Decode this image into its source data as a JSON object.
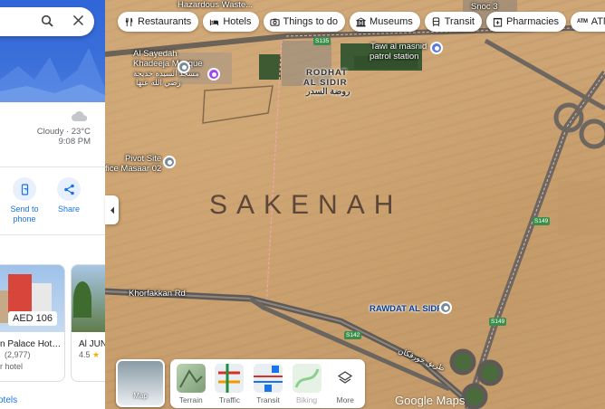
{
  "search": {
    "search_icon": "search-icon",
    "close_icon": "close-icon"
  },
  "weather": {
    "icon": "cloud-icon",
    "line1": "Cloudy · 23°C",
    "line2": "9:08 PM"
  },
  "actions": [
    {
      "label_line1": "Send to",
      "label_line2": "phone",
      "icon": "send-to-phone-icon"
    },
    {
      "label_line1": "Share",
      "label_line2": "",
      "icon": "share-icon"
    }
  ],
  "hotels": [
    {
      "price": "AED 106",
      "name": "n Palace Hot…",
      "rating_count": "(2,977)",
      "type": "r hotel"
    },
    {
      "name": "Al JUN",
      "rating": "4.5",
      "star": "★"
    }
  ],
  "hotels_link": "otels",
  "chips": [
    {
      "label": "Restaurants",
      "icon": "fork-knife-icon"
    },
    {
      "label": "Hotels",
      "icon": "bed-icon"
    },
    {
      "label": "Things to do",
      "icon": "camera-icon"
    },
    {
      "label": "Museums",
      "icon": "museum-icon"
    },
    {
      "label": "Transit",
      "icon": "train-icon"
    },
    {
      "label": "Pharmacies",
      "icon": "pharmacy-icon"
    },
    {
      "label": "ATMs",
      "icon": "atm-icon",
      "icon_text": "ATM"
    }
  ],
  "map_labels": {
    "hazardous": "Hazardous Waste...",
    "mosque_en1": "Al Sayedah",
    "mosque_en2": "Khadeeja Mosque",
    "mosque_ar": "مسجد السيدة خديجة",
    "mosque_ar2": "رضي الله عنها",
    "rodhat1": "RODHAT",
    "rodhat2": "AL SIDIR",
    "rodhat_ar": "روضة السدر",
    "tawi1": "Tawi al masnid",
    "tawi2": "patrol station",
    "pivot1": "Pivot Site",
    "pivot2": "fice Masaar 02",
    "khorfakkan": "Khorfakkan Rd",
    "rawdat": "RAWDAT AL SIDR",
    "road_ar": "طريق خورفكان",
    "snoc": "Snoc 3",
    "watermark": "SAKENAH"
  },
  "road_badges": [
    "S135",
    "S149",
    "S149",
    "S142"
  ],
  "layers": {
    "map_label": "Map",
    "options": [
      "Terrain",
      "Traffic",
      "Transit",
      "Biking",
      "More"
    ]
  },
  "google_logo": "Google Maps"
}
